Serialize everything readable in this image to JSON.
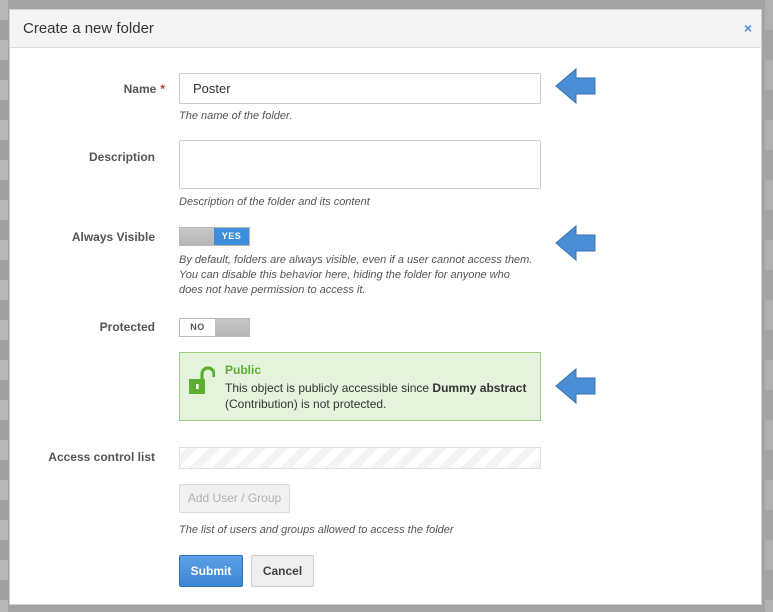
{
  "dialog": {
    "title": "Create a new folder",
    "close_glyph": "×"
  },
  "form": {
    "name": {
      "label": "Name",
      "required_mark": "*",
      "value": "Poster",
      "help": "The name of the folder."
    },
    "description": {
      "label": "Description",
      "value": "",
      "help": "Description of the folder and its content"
    },
    "always_visible": {
      "label": "Always Visible",
      "state": "YES",
      "help": "By default, folders are always visible, even if a user cannot access them. You can disable this behavior here, hiding the folder for anyone who does not have permission to access it."
    },
    "protected": {
      "label": "Protected",
      "state": "NO"
    },
    "protection_notice": {
      "title": "Public",
      "text_before": "This object is publicly accessible since ",
      "text_bold": "Dummy abstract",
      "text_after": " (Contribution) is not protected.",
      "icon": "unlock-icon"
    },
    "acl": {
      "label": "Access control list",
      "add_button": "Add User / Group",
      "help": "The list of users and groups allowed to access the folder"
    }
  },
  "actions": {
    "submit": "Submit",
    "cancel": "Cancel"
  },
  "colors": {
    "accent": "#3e8ede",
    "annotation_arrow": "#4a8fd6",
    "success_text": "#5cb030",
    "success_bg": "#e5f3dd",
    "required": "#c0392b"
  }
}
